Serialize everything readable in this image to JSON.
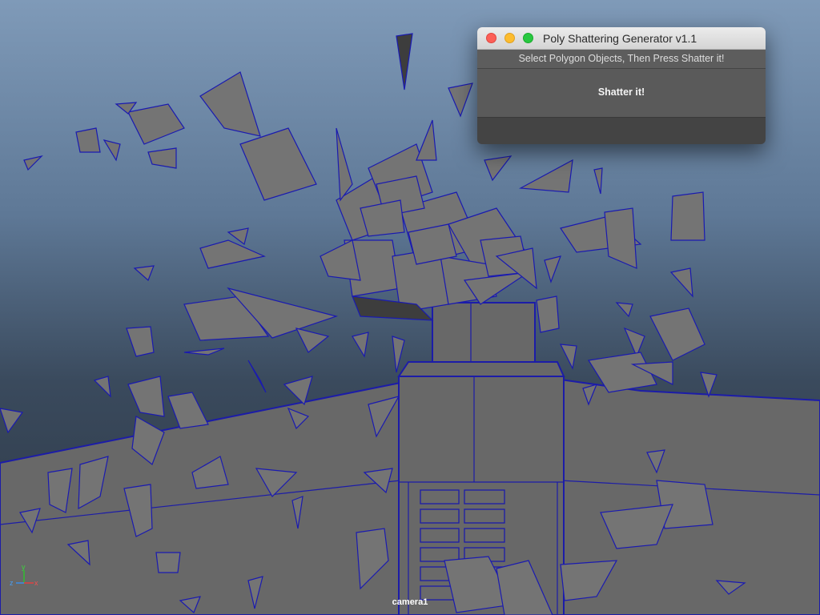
{
  "tool_window": {
    "title": "Poly Shattering Generator v1.1",
    "instruction": "Select Polygon Objects, Then Press Shatter it!",
    "shatter_button_label": "Shatter it!",
    "controls": {
      "close": "close",
      "minimize": "minimize",
      "zoom": "zoom"
    }
  },
  "viewport": {
    "camera_label": "camera1",
    "axis_labels": {
      "x": "x",
      "y": "y",
      "z": "z"
    }
  },
  "colors": {
    "sky_top": "#7f9ab8",
    "wireframe": "#1a1ab0",
    "mesh": "#747474",
    "close": "#fc5f57",
    "minimize": "#fdbc2e",
    "zoom": "#28c840"
  }
}
